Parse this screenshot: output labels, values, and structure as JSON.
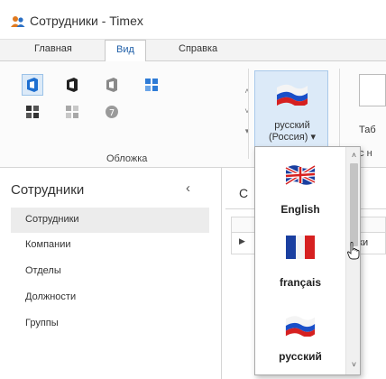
{
  "window": {
    "title": "Сотрудники - Timex"
  },
  "ribbon_tabs": [
    "Главная",
    "Вид",
    "Справка"
  ],
  "ribbon": {
    "skins_group_label": "Обложка",
    "language_button": {
      "line1": "русский",
      "line2": "(Россия) ▾"
    },
    "table_button_label": "Таб",
    "group2_label": "ос н"
  },
  "nav": {
    "title": "Сотрудники",
    "collapse_glyph": "‹",
    "items": [
      "Сотрудники",
      "Компании",
      "Отделы",
      "Должности",
      "Группы"
    ],
    "selected_index": 0
  },
  "content": {
    "tab_title": "С",
    "row_text": "ики"
  },
  "language_dropdown": {
    "items": [
      {
        "label": "English",
        "icon": "uk-flag-icon"
      },
      {
        "label": "français",
        "icon": "france-flag-icon"
      },
      {
        "label": "русский",
        "icon": "russia-flag-icon"
      }
    ]
  },
  "colors": {
    "accent": "#1f5fa8",
    "selection": "#dceaf8",
    "nav_selected": "#ececec"
  }
}
